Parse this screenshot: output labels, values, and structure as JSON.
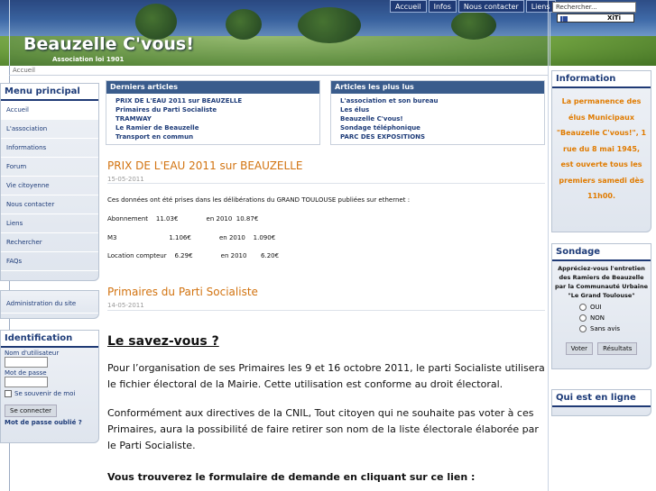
{
  "header": {
    "site_title": "Beauzelle C'vous!",
    "subtitle": "Association loi 1901",
    "nav": [
      "Accueil",
      "Infos",
      "Nous contacter",
      "Liens"
    ],
    "search_placeholder": "Rechercher...",
    "xiti": "XiTi"
  },
  "breadcrumb": "Accueil",
  "menu": {
    "title": "Menu principal",
    "items": [
      "Accueil",
      "L'association",
      "Informations",
      "Forum",
      "Vie citoyenne",
      "Nous contacter",
      "Liens",
      "Rechercher",
      "FAQs"
    ],
    "admin": "Administration du site"
  },
  "login": {
    "title": "Identification",
    "user_label": "Nom d'utilisateur",
    "pass_label": "Mot de passe",
    "remember": "Se souvenir de moi",
    "submit": "Se connecter",
    "forgot": "Mot de passe oublié ?"
  },
  "latest": {
    "title": "Derniers articles",
    "items": [
      "PRIX DE L'EAU 2011 sur BEAUZELLE",
      "Primaires du Parti Socialiste",
      "TRAMWAY",
      "Le Ramier de Beauzelle",
      "Transport en commun"
    ]
  },
  "popular": {
    "title": "Articles les plus lus",
    "items": [
      "L'association et son bureau",
      "Les élus",
      "Beauzelle C'vous!",
      "Sondage téléphonique",
      "PARC DES EXPOSITIONS"
    ]
  },
  "article1": {
    "title": "PRIX DE L'EAU 2011 sur BEAUZELLE",
    "date": "15-05-2011",
    "intro": "Ces données ont été prises dans les délibérations du GRAND TOULOUSE publiées sur ethernet :",
    "row1": "Abonnement    11.03€              en 2010  10.87€",
    "row2": "M3                          1.106€              en 2010    1.090€",
    "row3": "Location compteur    6.29€              en 2010       6.20€"
  },
  "article2": {
    "title": "Primaires du Parti Socialiste",
    "date": "14-05-2011",
    "heading": "Le savez-vous ?",
    "p1": "Pour l’organisation de ses Primaires les 9 et 16 octobre 2011, le parti Socialiste utilisera le fichier électoral de la Mairie. Cette utilisation est conforme au droit électoral.",
    "p2": "Conformément aux directives de la CNIL,  Tout citoyen qui ne souhaite pas voter à ces Primaires,   aura la possibilité de faire retirer son nom de la liste électorale élaborée par le Parti Socialiste.",
    "p3": "Vous trouverez le formulaire de demande en cliquant sur ce lien :"
  },
  "info": {
    "title": "Information",
    "text": "La permanence des élus Municipaux \"Beauzelle C'vous!\", 1 rue du 8 mai 1945, est ouverte tous les premiers samedi dès 11h00."
  },
  "poll": {
    "title": "Sondage",
    "question": "Appréciez-vous l'entretien des Ramiers de Beauzelle par la Communauté Urbaine \"Le Grand Toulouse\"",
    "options": [
      "OUI",
      "NON",
      "Sans avis"
    ],
    "vote": "Voter",
    "results": "Résultats"
  },
  "online": {
    "title": "Qui est en ligne"
  },
  "colors": {
    "accent": "#1f3a75",
    "title_orange": "#d27310",
    "info_orange": "#e07b00"
  }
}
